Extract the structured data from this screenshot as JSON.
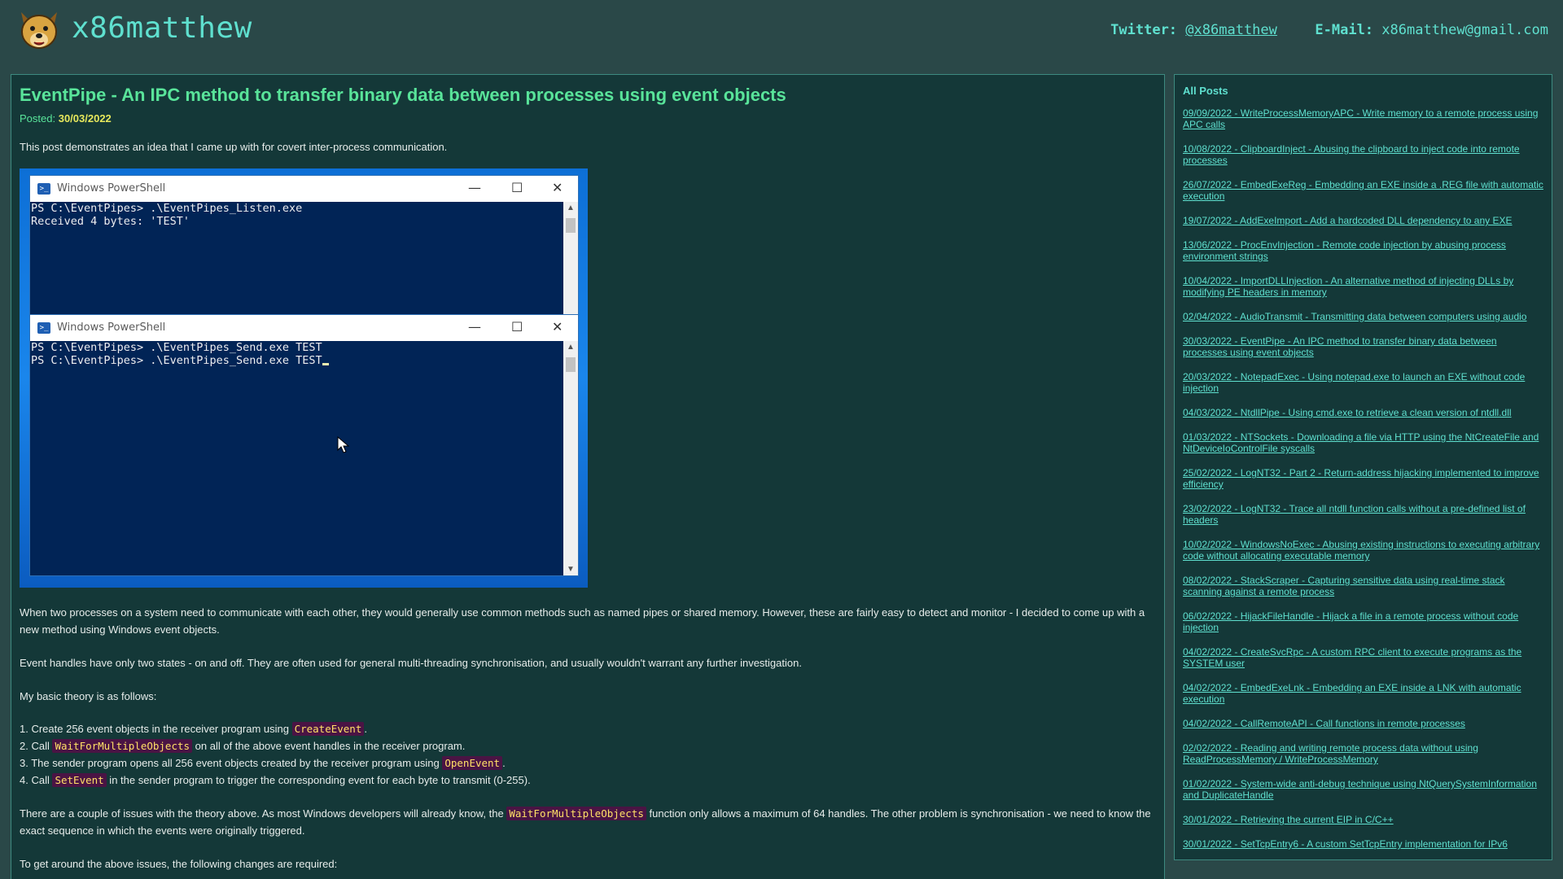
{
  "header": {
    "site_name": "x86matthew",
    "logo_icon": "dog-face-logo",
    "twitter_label": "Twitter:",
    "twitter_handle": "@x86matthew",
    "email_label": "E-Mail:",
    "email": "x86matthew@gmail.com"
  },
  "article": {
    "title": "EventPipe - An IPC method to transfer binary data between processes using event objects",
    "posted_label": "Posted:",
    "posted_date": "30/03/2022",
    "intro": "This post demonstrates an idea that I came up with for covert inter-process communication.",
    "screenshot": {
      "window1": {
        "title": "Windows PowerShell",
        "lines": [
          "PS C:\\EventPipes> .\\EventPipes_Listen.exe",
          "Received 4 bytes: 'TEST'"
        ]
      },
      "window2": {
        "title": "Windows PowerShell",
        "lines": [
          "PS C:\\EventPipes> .\\EventPipes_Send.exe TEST",
          "PS C:\\EventPipes> .\\EventPipes_Send.exe TEST"
        ]
      },
      "controls": {
        "minimize": "—",
        "maximize": "☐",
        "close": "✕"
      }
    },
    "para1": "When two processes on a system need to communicate with each other, they would generally use common methods such as named pipes or shared memory. However, these are fairly easy to detect and monitor - I decided to come up with a new method using Windows event objects.",
    "para2": "Event handles have only two states - on and off. They are often used for general multi-threading synchronisation, and usually wouldn't warrant any further investigation.",
    "para3": "My basic theory is as follows:",
    "steps": [
      {
        "pre": "1. Create 256 event objects in the receiver program using ",
        "code": "CreateEvent",
        "post": "."
      },
      {
        "pre": "2. Call ",
        "code": "WaitForMultipleObjects",
        "post": " on all of the above event handles in the receiver program."
      },
      {
        "pre": "3. The sender program opens all 256 event objects created by the receiver program using ",
        "code": "OpenEvent",
        "post": "."
      },
      {
        "pre": "4. Call ",
        "code": "SetEvent",
        "post": " in the sender program to trigger the corresponding event for each byte to transmit (0-255)."
      }
    ],
    "para4_pre": "There are a couple of issues with the theory above. As most Windows developers will already know, the ",
    "para4_code": "WaitForMultipleObjects",
    "para4_post": " function only allows a maximum of 64 handles. The other problem is synchronisation - we need to know the exact sequence in which the events were originally triggered.",
    "para5": "To get around the above issues, the following changes are required:"
  },
  "sidebar": {
    "title": "All Posts",
    "posts": [
      "09/09/2022 - WriteProcessMemoryAPC - Write memory to a remote process using APC calls",
      "10/08/2022 - ClipboardInject - Abusing the clipboard to inject code into remote processes",
      "26/07/2022 - EmbedExeReg - Embedding an EXE inside a .REG file with automatic execution",
      "19/07/2022 - AddExeImport - Add a hardcoded DLL dependency to any EXE",
      "13/06/2022 - ProcEnvInjection - Remote code injection by abusing process environment strings",
      "10/04/2022 - ImportDLLInjection - An alternative method of injecting DLLs by modifying PE headers in memory",
      "02/04/2022 - AudioTransmit - Transmitting data between computers using audio",
      "30/03/2022 - EventPipe - An IPC method to transfer binary data between processes using event objects",
      "20/03/2022 - NotepadExec - Using notepad.exe to launch an EXE without code injection",
      "04/03/2022 - NtdllPipe - Using cmd.exe to retrieve a clean version of ntdll.dll",
      "01/03/2022 - NTSockets - Downloading a file via HTTP using the NtCreateFile and NtDeviceIoControlFile syscalls",
      "25/02/2022 - LogNT32 - Part 2 - Return-address hijacking implemented to improve efficiency",
      "23/02/2022 - LogNT32 - Trace all ntdll function calls without a pre-defined list of headers",
      "10/02/2022 - WindowsNoExec - Abusing existing instructions to executing arbitrary code without allocating executable memory",
      "08/02/2022 - StackScraper - Capturing sensitive data using real-time stack scanning against a remote process",
      "06/02/2022 - HijackFileHandle - Hijack a file in a remote process without code injection",
      "04/02/2022 - CreateSvcRpc - A custom RPC client to execute programs as the SYSTEM user",
      "04/02/2022 - EmbedExeLnk - Embedding an EXE inside a LNK with automatic execution",
      "04/02/2022 - CallRemoteAPI - Call functions in remote processes",
      "02/02/2022 - Reading and writing remote process data without using ReadProcessMemory / WriteProcessMemory",
      "01/02/2022 - System-wide anti-debug technique using NtQuerySystemInformation and DuplicateHandle",
      "30/01/2022 - Retrieving the current EIP in C/C++",
      "30/01/2022 - SetTcpEntry6 - A custom SetTcpEntry implementation for IPv6"
    ]
  },
  "colors": {
    "page_bg": "#2a4848",
    "panel_bg": "#143838",
    "accent_teal": "#5fe0cf",
    "title_green": "#59e49a",
    "date_yellow": "#e7e85c",
    "code_bg": "#4a1444",
    "code_fg": "#ffe066",
    "powershell_bg": "#012456"
  }
}
